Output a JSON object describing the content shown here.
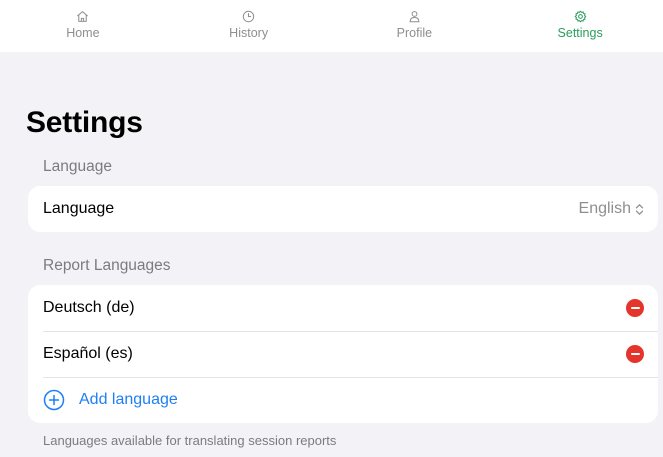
{
  "tabs": [
    {
      "label": "Home",
      "icon": "home-icon",
      "active": false
    },
    {
      "label": "History",
      "icon": "clock-icon",
      "active": false
    },
    {
      "label": "Profile",
      "icon": "person-icon",
      "active": false
    },
    {
      "label": "Settings",
      "icon": "gear-icon",
      "active": true
    }
  ],
  "page": {
    "title": "Settings"
  },
  "language_section": {
    "header": "Language",
    "row_label": "Language",
    "value": "English"
  },
  "report_section": {
    "header": "Report Languages",
    "items": [
      {
        "label": "Deutsch (de)"
      },
      {
        "label": "Español (es)"
      }
    ],
    "add_label": "Add language",
    "footer": "Languages available for translating session reports"
  },
  "colors": {
    "accent": "#2a9d5c",
    "link": "#1e7ff5",
    "destructive": "#e5342b",
    "background": "#f2f2f7"
  }
}
